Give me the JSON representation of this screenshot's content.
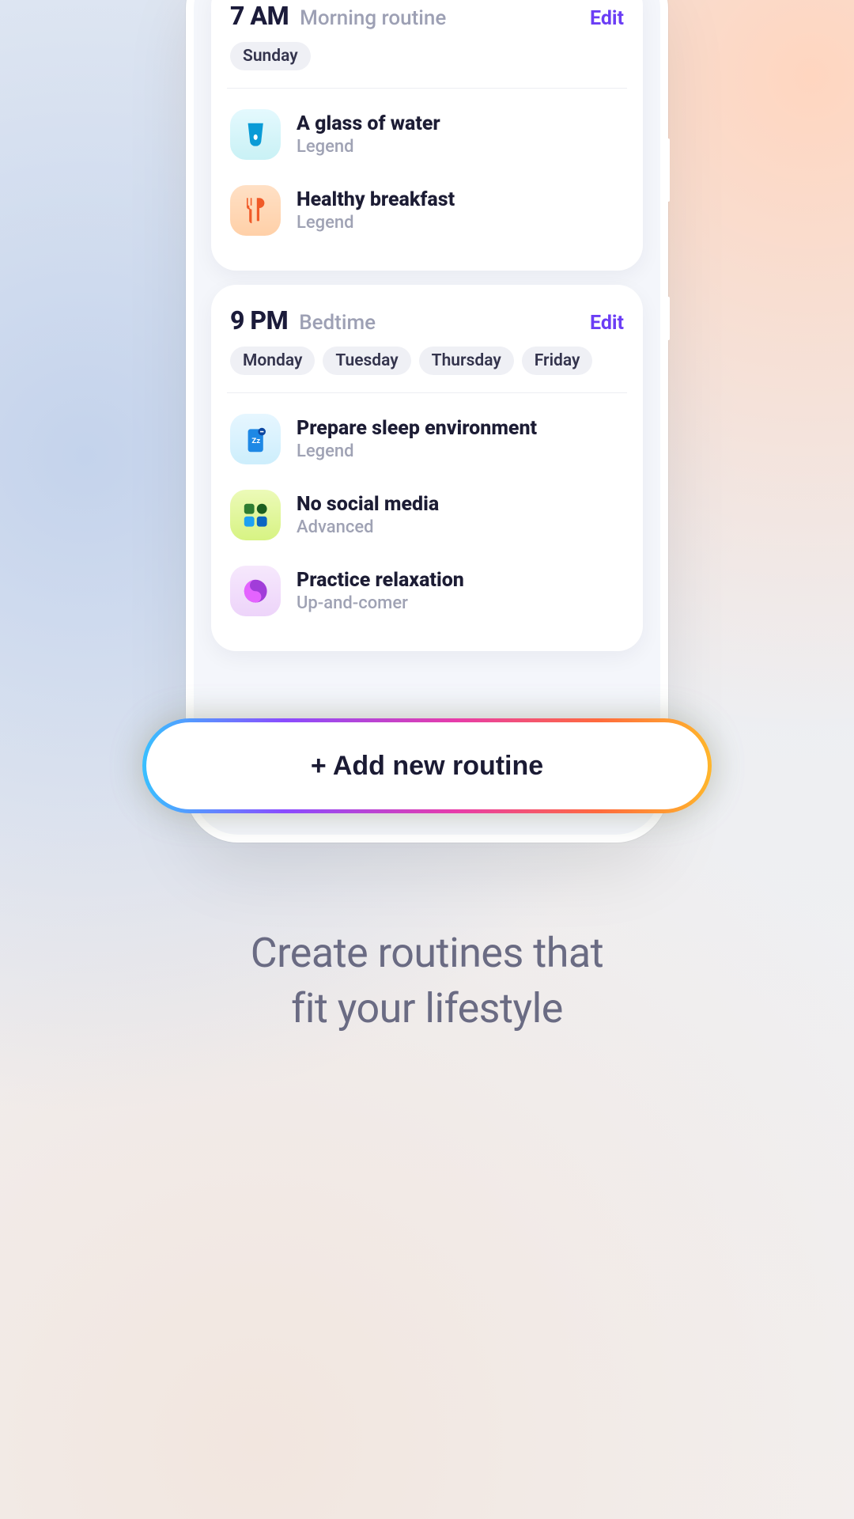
{
  "routines": [
    {
      "time": "7 AM",
      "name": "Morning routine",
      "edit": "Edit",
      "days": [
        "Sunday"
      ],
      "habits": [
        {
          "title": "A glass of water",
          "level": "Legend",
          "icon": "water",
          "bg": "bg-cyan"
        },
        {
          "title": "Healthy breakfast",
          "level": "Legend",
          "icon": "utensils",
          "bg": "bg-peach"
        }
      ]
    },
    {
      "time": "9 PM",
      "name": "Bedtime",
      "edit": "Edit",
      "days": [
        "Monday",
        "Tuesday",
        "Thursday",
        "Friday"
      ],
      "habits": [
        {
          "title": "Prepare sleep environment",
          "level": "Legend",
          "icon": "sleep",
          "bg": "bg-sky"
        },
        {
          "title": "No social media",
          "level": "Advanced",
          "icon": "social",
          "bg": "bg-lime"
        },
        {
          "title": "Practice relaxation",
          "level": "Up-and-comer",
          "icon": "yinyang",
          "bg": "bg-lilac"
        }
      ]
    }
  ],
  "add_button": "+ Add new routine",
  "tagline_line1": "Create routines that",
  "tagline_line2": "fit your lifestyle"
}
